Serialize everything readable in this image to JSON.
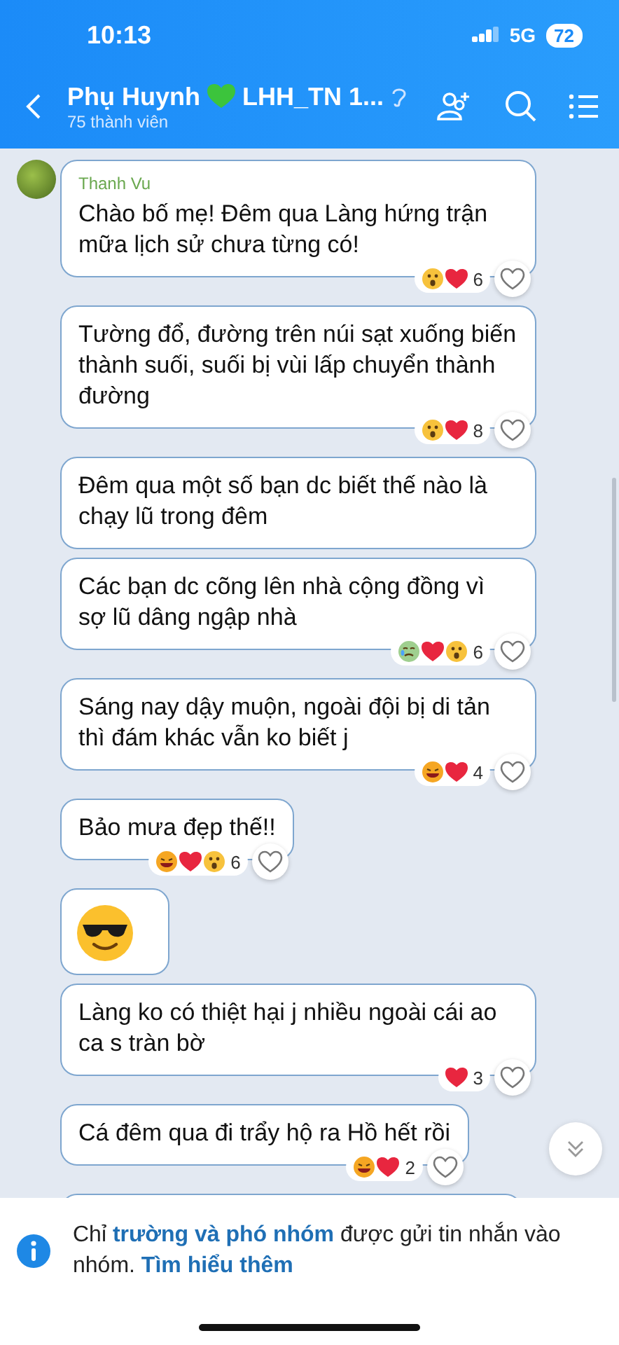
{
  "status_bar": {
    "time": "10:13",
    "network": "5G",
    "battery": "72"
  },
  "header": {
    "title_start": "Phụ Huynh",
    "title_end": "LHH_TN 1...",
    "subtitle": "75 thành viên"
  },
  "messages": [
    {
      "kind": "text",
      "sender": "Thanh Vu",
      "text": "Chào bố mẹ! Đêm qua Làng hứng trận mữa lịch sử chưa từng có!",
      "reactions": {
        "icons": [
          {
            "kind": "wow"
          },
          {
            "kind": "heart"
          }
        ],
        "count": "6"
      }
    },
    {
      "kind": "text",
      "text": "Tường đổ, đường trên núi sạt xuống biến thành suối, suối bị vùi lấp chuyển thành đường",
      "reactions": {
        "icons": [
          {
            "kind": "wow"
          },
          {
            "kind": "heart"
          }
        ],
        "count": "8"
      }
    },
    {
      "kind": "text",
      "text": "Đêm qua một số bạn dc biết thế nào là chạy lũ trong đêm"
    },
    {
      "kind": "text",
      "text": "Các bạn dc cõng lên nhà cộng đồng vì sợ lũ dâng ngập nhà",
      "reactions": {
        "icons": [
          {
            "kind": "tear"
          },
          {
            "kind": "heart"
          },
          {
            "kind": "wow"
          }
        ],
        "count": "6"
      }
    },
    {
      "kind": "text",
      "text": "Sáng nay dậy muộn, ngoài đội bị di tản thì đám khác vẫn ko biết j",
      "reactions": {
        "icons": [
          {
            "kind": "laugh"
          },
          {
            "kind": "heart"
          }
        ],
        "count": "4"
      }
    },
    {
      "kind": "text",
      "text": "Bảo mưa đẹp thế!!",
      "reactions": {
        "icons": [
          {
            "kind": "laugh"
          },
          {
            "kind": "heart"
          },
          {
            "kind": "wow"
          }
        ],
        "count": "6"
      }
    },
    {
      "kind": "sticker"
    },
    {
      "kind": "text",
      "text": "Làng ko có thiệt hại j nhiều ngoài cái ao ca s tràn bờ",
      "reactions": {
        "icons": [
          {
            "kind": "heart"
          }
        ],
        "count": "3"
      }
    },
    {
      "kind": "text",
      "text": "Cá đêm qua đi trẩy hộ ra Hồ hết rồi",
      "reactions": {
        "icons": [
          {
            "kind": "laugh"
          },
          {
            "kind": "heart"
          }
        ],
        "count": "2"
      }
    },
    {
      "kind": "cut"
    }
  ],
  "notice": [
    {
      "kind": "text",
      "text": "Chỉ "
    },
    {
      "kind": "link",
      "text": "trường và phó nhóm"
    },
    {
      "kind": "text",
      "text": " được gửi tin nhắn vào nhóm. "
    },
    {
      "kind": "link",
      "text": "Tìm hiểu thêm"
    }
  ]
}
